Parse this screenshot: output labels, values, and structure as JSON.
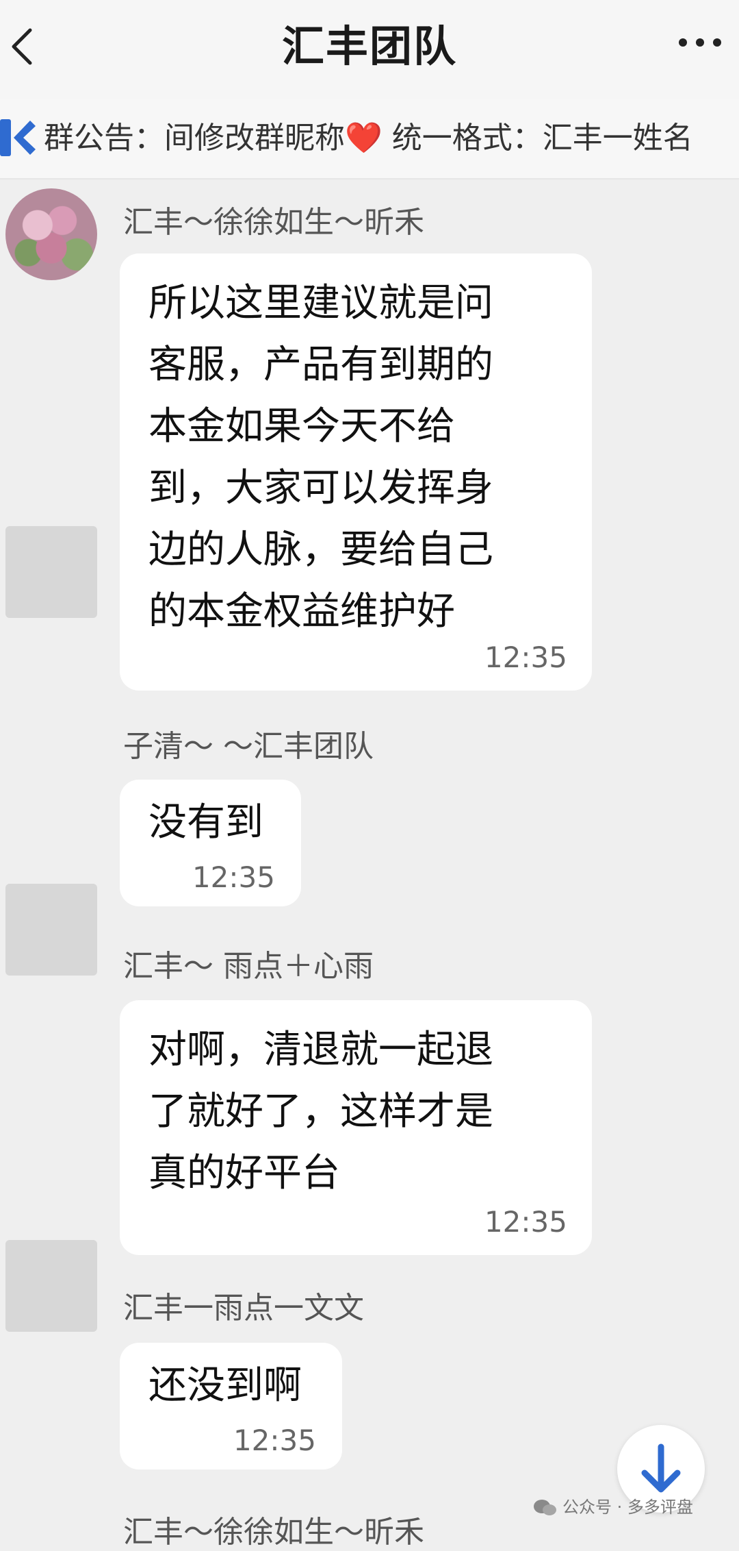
{
  "header": {
    "title": "汇丰团队",
    "back_icon": "chevron-left-icon",
    "more_icon": "more-dots-icon"
  },
  "announcement": {
    "text": "群公告：间修改群昵称",
    "heart": "❤️",
    "text2": " 统一格式：汇丰一姓名"
  },
  "messages": [
    {
      "sender": "汇丰～徐徐如生～昕禾",
      "text": "所以这里建议就是问\n客服，产品有到期的\n本金如果今天不给\n到，大家可以发挥身\n边的人脉，要给自己\n的本金权益维护好",
      "time": "12:35"
    },
    {
      "sender": "子清～        ～汇丰团队",
      "text": "没有到",
      "time": "12:35"
    },
    {
      "sender": "汇丰～ 雨点＋心雨",
      "text": "对啊，清退就一起退\n了就好了，这样才是\n真的好平台",
      "time": "12:35"
    },
    {
      "sender": "汇丰一雨点一文文",
      "text": "还没到啊",
      "time": "12:35"
    },
    {
      "sender": "汇丰～徐徐如生～昕禾"
    }
  ],
  "watermark": {
    "text": "公众号 · 多多评盘"
  },
  "colors": {
    "accent": "#2f6bd0",
    "background": "#efefef",
    "bubble": "#ffffff"
  }
}
